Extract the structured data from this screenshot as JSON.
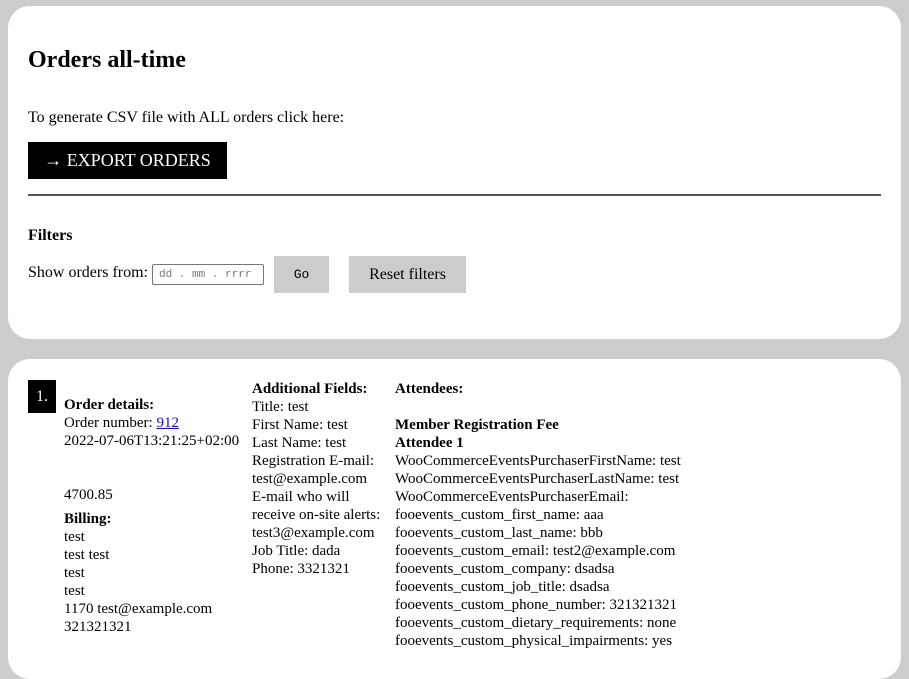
{
  "header": {
    "title": "Orders all-time",
    "intro": "To generate CSV file with ALL orders click here:",
    "export_label": "→ EXPORT ORDERS"
  },
  "filters": {
    "heading": "Filters",
    "label": "Show orders from:",
    "date_placeholder": "dd . mm . rrrr",
    "go_label": "Go",
    "reset_label": "Reset filters"
  },
  "order": {
    "index": "1.",
    "details_heading": "Order details:",
    "number_label": "Order number: ",
    "number": "912",
    "datetime": "2022-07-06T13:21:25+02:00",
    "total": "4700.85",
    "billing_heading": "Billing:",
    "billing_lines": [
      "test",
      "test test",
      "test",
      "test",
      "1170 test@example.com",
      "321321321"
    ],
    "additional_heading": "Additional Fields:",
    "additional_lines": [
      "Title: test",
      "First Name: test",
      "Last Name: test",
      "Registration E-mail:",
      "test@example.com",
      "E-mail who will",
      "receive on-site alerts:",
      "test3@example.com",
      "Job Title: dada",
      "Phone: 3321321"
    ],
    "attendees_heading": "Attendees:",
    "ticket_name": "Member Registration Fee",
    "attendee_label": "Attendee 1",
    "attendee_lines": [
      "WooCommerceEventsPurchaserFirstName: test",
      "WooCommerceEventsPurchaserLastName: test",
      "WooCommerceEventsPurchaserEmail:",
      "fooevents_custom_first_name: aaa",
      "fooevents_custom_last_name: bbb",
      "fooevents_custom_email: test2@example.com",
      "fooevents_custom_company: dsadsa",
      "fooevents_custom_job_title: dsadsa",
      "fooevents_custom_phone_number: 321321321",
      "fooevents_custom_dietary_requirements: none",
      "fooevents_custom_physical_impairments: yes"
    ]
  }
}
